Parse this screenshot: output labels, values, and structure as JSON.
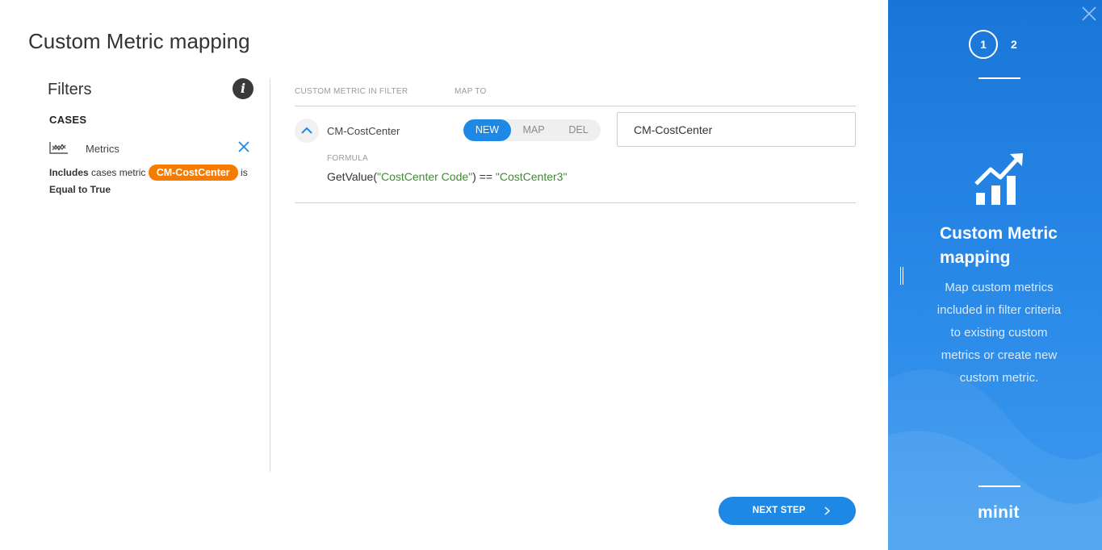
{
  "page": {
    "title": "Custom Metric mapping"
  },
  "filters": {
    "title": "Filters",
    "info_icon": "info-icon",
    "section": "CASES",
    "item": {
      "icon": "metrics-icon",
      "label": "Metrics",
      "remove_icon": "close-icon",
      "desc_bold_1": "Includes",
      "desc_1": " cases metric ",
      "metric": "CM-CostCenter",
      "desc_2": " is",
      "desc_bold_2": "Equal to True"
    }
  },
  "table": {
    "headers": {
      "metric": "CUSTOM METRIC IN FILTER",
      "map_to": "MAP TO"
    },
    "rows": [
      {
        "name": "CM-CostCenter",
        "options": [
          "NEW",
          "MAP",
          "DEL"
        ],
        "selected": "NEW",
        "map_value": "CM-CostCenter",
        "formula_label": "FORMULA",
        "formula": {
          "p1": "GetValue(",
          "s1": "\"CostCenter Code\"",
          "p2": ") == ",
          "s2": "\"CostCenter3\""
        }
      }
    ]
  },
  "actions": {
    "next_label": "NEXT STEP"
  },
  "side": {
    "steps": [
      "1",
      "2"
    ],
    "current_step": "1",
    "title": "Custom Metric mapping",
    "description": "Map custom metrics included in filter criteria to existing custom metrics or create new custom metric.",
    "brand": "minit",
    "colors": {
      "accent": "#1e88e5",
      "pill": "#f57c00",
      "string": "#3c8d2f"
    }
  }
}
